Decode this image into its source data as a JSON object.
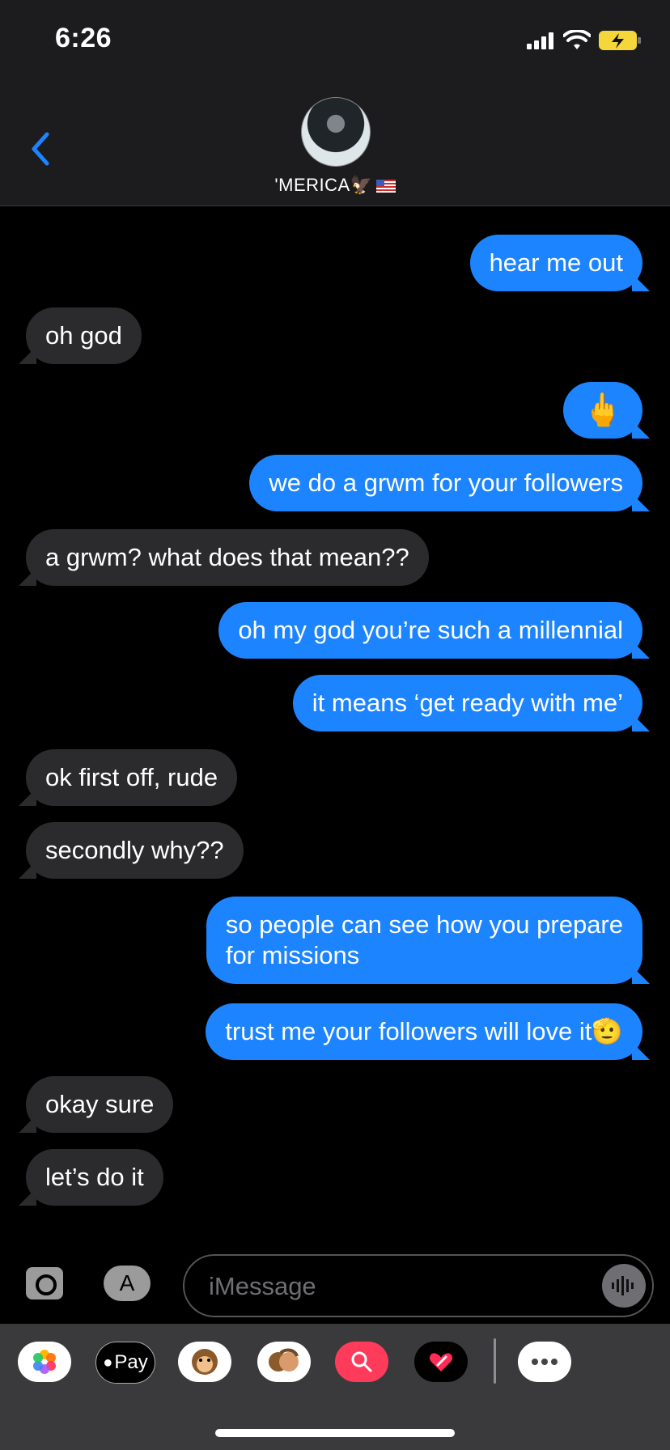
{
  "status": {
    "time": "6:26"
  },
  "header": {
    "contact_name": "'MERICA🦅"
  },
  "messages": [
    {
      "side": "sent",
      "text": "hear me out"
    },
    {
      "side": "received",
      "text": "oh god"
    },
    {
      "side": "sent",
      "text": "🖕"
    },
    {
      "side": "sent",
      "text": "we do a grwm for your followers"
    },
    {
      "side": "received",
      "text": "a grwm? what does that mean??"
    },
    {
      "side": "sent",
      "text": "oh my god you’re such a millennial"
    },
    {
      "side": "sent",
      "text": "it means ‘get ready with me’"
    },
    {
      "side": "received",
      "text": "ok first off, rude"
    },
    {
      "side": "received",
      "text": "secondly why??"
    },
    {
      "side": "sent",
      "text": "so people can see how you prepare\nfor missions"
    },
    {
      "side": "sent",
      "text": "trust me your followers will love it🫡"
    },
    {
      "side": "received",
      "text": "okay sure"
    },
    {
      "side": "received",
      "text": "let’s do it"
    }
  ],
  "composer": {
    "placeholder": "iMessage"
  },
  "tray": {
    "apple_pay_label": "Pay"
  },
  "colors": {
    "sent_bubble": "#1d84ff",
    "received_bubble": "#2b2b2d",
    "accent": "#1d84ff"
  }
}
